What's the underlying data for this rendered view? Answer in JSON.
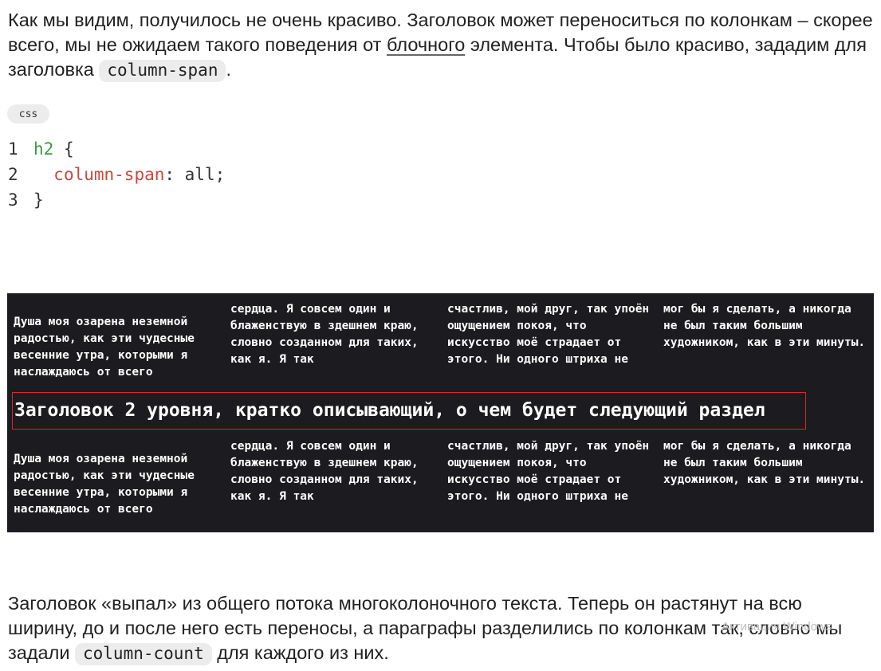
{
  "intro": {
    "text_1": "Как мы видим, получилось не очень красиво. Заголовок может переноситься по колонкам – скорее всего, мы не ожидаем такого поведения от ",
    "link": "блочного",
    "text_2": " элемента. Чтобы было красиво, зададим для заголовка ",
    "code": "column-span",
    "text_3": "."
  },
  "code_block": {
    "language": "css",
    "lines": [
      {
        "number": "1",
        "selector": "h2",
        "brace_open": " {"
      },
      {
        "number": "2",
        "property": "column-span",
        "value": ": all;"
      },
      {
        "number": "3",
        "brace_close": "}"
      }
    ]
  },
  "demo": {
    "group_1": {
      "col_1": "Душа моя озарена неземной радостью, как эти чудесные весенние утра, которыми я наслаждаюсь от всего",
      "col_2": "сердца. Я совсем один и блаженствую в здешнем краю, словно созданном для таких, как я. Я так",
      "col_3": "счастлив, мой друг, так упоён ощущением покоя, что искусство моё страдает от этого. Ни одного штриха не",
      "col_4": "мог бы я сделать, а никогда не был таким большим художником, как в эти минуты."
    },
    "heading": "Заголовок 2 уровня, кратко описывающий, о чем будет следующий раздел",
    "group_2": {
      "col_1": "Душа моя озарена неземной радостью, как эти чудесные весенние утра, которыми я наслаждаюсь от всего",
      "col_2": "сердца. Я совсем один и блаженствую в здешнем краю, словно созданном для таких, как я. Я так",
      "col_3": "счастлив, мой друг, так упоён ощущением покоя, что искусство моё страдает от этого. Ни одного штриха не",
      "col_4": "мог бы я сделать, а никогда не был таким большим художником, как в эти минуты."
    },
    "colors": {
      "background": "#1c1c20",
      "heading_border": "#d02a2a"
    }
  },
  "outro": {
    "text_1": "Заголовок «выпал» из общего потока многоколоночного текста. Теперь он растянут на всю ширину, до и после него есть переносы, а параграфы разделились по колонкам так, словно мы задали ",
    "code": "column-count",
    "text_2": " для каждого из них."
  },
  "watermark": "Активация Windows"
}
